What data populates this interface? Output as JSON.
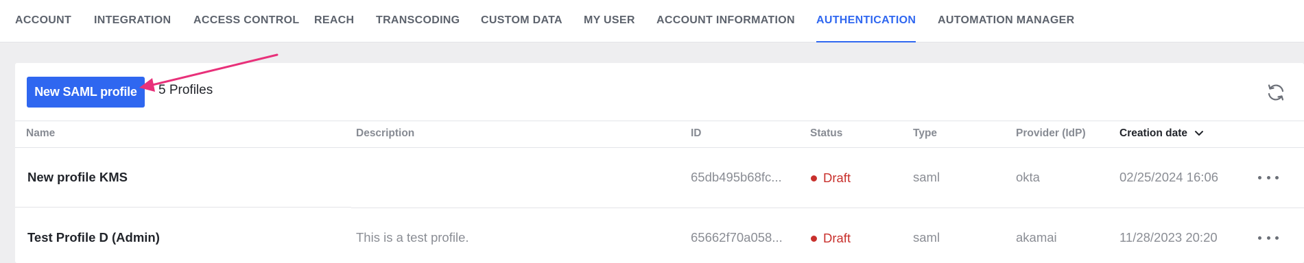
{
  "nav": {
    "tabs": [
      {
        "label": "ACCOUNT"
      },
      {
        "label": "INTEGRATION"
      },
      {
        "label": "ACCESS CONTROL"
      },
      {
        "label": "REACH"
      },
      {
        "label": "TRANSCODING"
      },
      {
        "label": "CUSTOM DATA"
      },
      {
        "label": "MY USER"
      },
      {
        "label": "ACCOUNT INFORMATION"
      },
      {
        "label": "AUTHENTICATION"
      },
      {
        "label": "AUTOMATION MANAGER"
      }
    ],
    "active_tab": "AUTHENTICATION"
  },
  "toolbar": {
    "new_button_label": "New SAML profile",
    "profile_count": "5 Profiles",
    "refresh_icon": "refresh-icon"
  },
  "annotation": {
    "arrow_color": "#e8317a"
  },
  "table": {
    "columns": [
      "Name",
      "Description",
      "ID",
      "Status",
      "Type",
      "Provider (IdP)",
      "Creation date"
    ],
    "sorted_column": "Creation date",
    "rows": [
      {
        "name": "New profile KMS",
        "description": "",
        "id": "65db495b68fc...",
        "status": "Draft",
        "type": "saml",
        "provider": "okta",
        "created": "02/25/2024 16:06"
      },
      {
        "name": "Test Profile D (Admin)",
        "description": "This is a test profile.",
        "id": "65662f70a058...",
        "status": "Draft",
        "type": "saml",
        "provider": "akamai",
        "created": "11/28/2023 20:20"
      }
    ]
  },
  "colors": {
    "accent": "#2f67f0",
    "status_draft": "#c8302c",
    "background": "#eeeef0"
  }
}
